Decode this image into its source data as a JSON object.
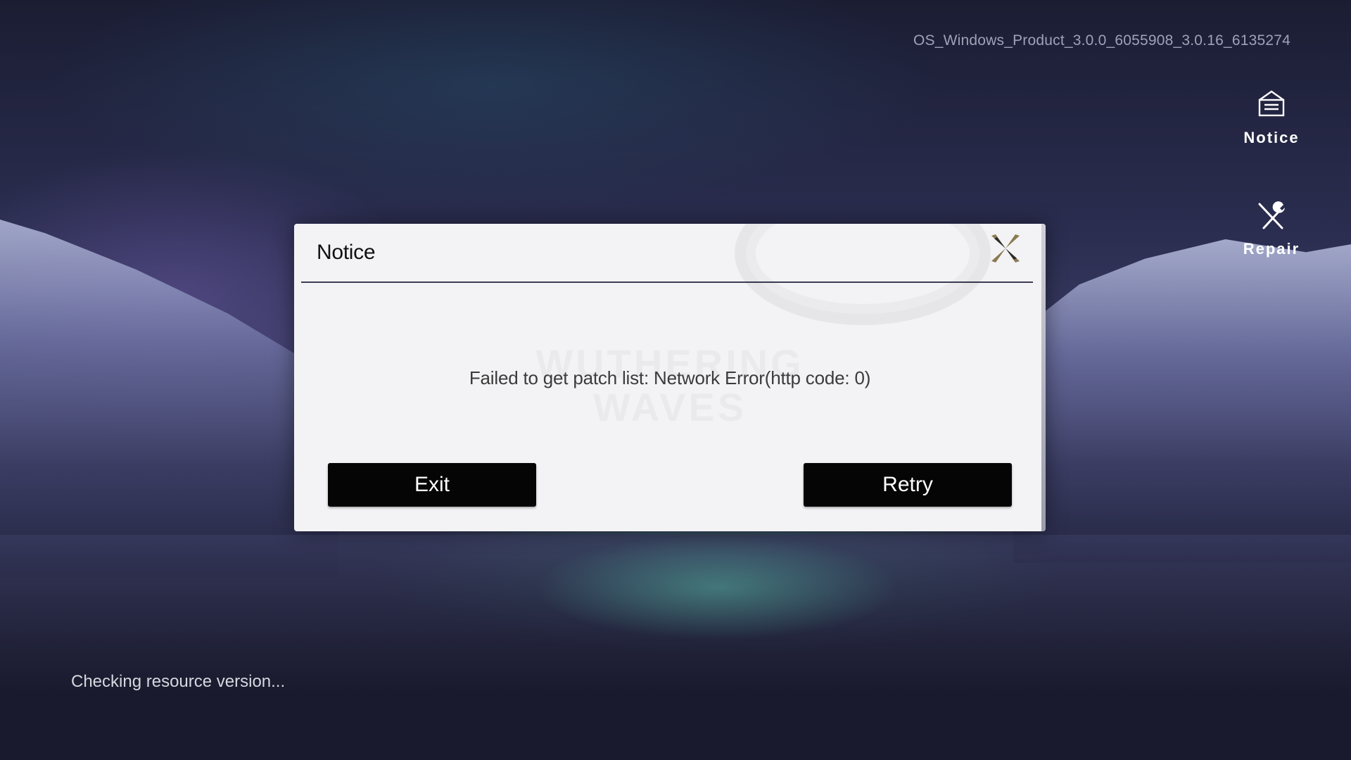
{
  "version": "OS_Windows_Product_3.0.0_6055908_3.0.16_6135274",
  "side_menu": {
    "notice": {
      "label": "Notice",
      "icon": "notice-box-icon"
    },
    "repair": {
      "label": "Repair",
      "icon": "wrench-screwdriver-icon"
    }
  },
  "dialog": {
    "title": "Notice",
    "close_icon": "close-icon",
    "message": "Failed to get patch list: Network Error(http code: 0)",
    "watermark": "WUTHERING\nWAVES",
    "buttons": {
      "exit": "Exit",
      "retry": "Retry"
    }
  },
  "status": "Checking resource version...",
  "colors": {
    "dialog_bg": "#f3f3f5",
    "button_bg": "#050505",
    "accent_gold": "#8c7a52"
  }
}
